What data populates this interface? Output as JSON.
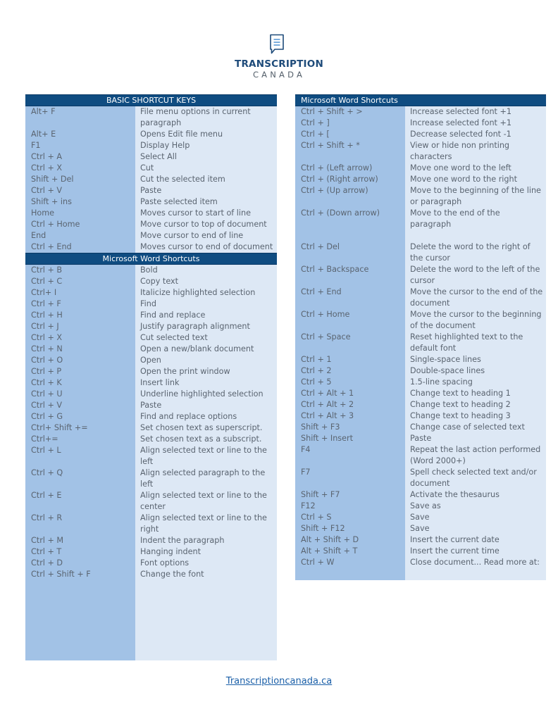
{
  "logo": {
    "icon": "document-chat-icon",
    "title": "TRANSCRIPTION",
    "subtitle": "CANADA"
  },
  "colors": {
    "header_bg": "#0f4c81",
    "key_column_bg": "#a2c2e6",
    "desc_column_bg": "#dde8f5",
    "text": "#5a6470",
    "brand": "#1e4b7a",
    "link": "#1a5fa8"
  },
  "left_panel": {
    "basic": {
      "title": "BASIC SHORTCUT KEYS",
      "rows": [
        {
          "key": "Alt+ F",
          "desc": "File menu options in current paragraph"
        },
        {
          "key": "Alt+ E",
          "desc": "Opens Edit file menu"
        },
        {
          "key": "F1",
          "desc": "Display Help"
        },
        {
          "key": "Ctrl + A",
          "desc": "Select All"
        },
        {
          "key": "Ctrl + X",
          "desc": "Cut"
        },
        {
          "key": "Shift + Del",
          "desc": "Cut the selected item"
        },
        {
          "key": "Ctrl + V",
          "desc": "Paste"
        },
        {
          "key": "Shift + ins",
          "desc": "Paste selected item"
        },
        {
          "key": "Home",
          "desc": "Moves cursor to start of line"
        },
        {
          "key": "Ctrl + Home",
          "desc": "Move cursor to top of document"
        },
        {
          "key": "End",
          "desc": "Move cursor to end of line"
        },
        {
          "key": "Ctrl + End",
          "desc": "Moves cursor to end of document"
        }
      ]
    },
    "word": {
      "title": "Microsoft Word Shortcuts",
      "rows": [
        {
          "key": "Ctrl + B",
          "desc": "Bold"
        },
        {
          "key": "Ctrl + C",
          "desc": "Copy text"
        },
        {
          "key": "Ctrl+ I",
          "desc": "Italicize highlighted selection"
        },
        {
          "key": "Ctrl + F",
          "desc": "Find"
        },
        {
          "key": "Ctrl + H",
          "desc": "Find and replace"
        },
        {
          "key": "Ctrl + J",
          "desc": "Justify paragraph alignment"
        },
        {
          "key": "Ctrl + X",
          "desc": "Cut selected text"
        },
        {
          "key": "Ctrl + N",
          "desc": "Open a new/blank document"
        },
        {
          "key": "Ctrl + O",
          "desc": "Open"
        },
        {
          "key": "Ctrl + P",
          "desc": "Open the print window"
        },
        {
          "key": "Ctrl + K",
          "desc": "Insert link"
        },
        {
          "key": "Ctrl + U",
          "desc": "Underline highlighted selection"
        },
        {
          "key": "Ctrl + V",
          "desc": "Paste"
        },
        {
          "key": "Ctrl + G",
          "desc": "Find and replace options"
        },
        {
          "key": "Ctrl+ Shift +=",
          "desc": "Set chosen text as superscript."
        },
        {
          "key": "Ctrl+=",
          "desc": "Set chosen text as a subscript."
        },
        {
          "key": "Ctrl + L",
          "desc": "Align selected text or line to the left"
        },
        {
          "key": "Ctrl + Q",
          "desc": "Align selected paragraph to the left"
        },
        {
          "key": "Ctrl + E",
          "desc": "Align selected text or line to the center"
        },
        {
          "key": "Ctrl + R",
          "desc": "Align selected text or line to the right"
        },
        {
          "key": "Ctrl + M",
          "desc": "Indent the paragraph"
        },
        {
          "key": "Ctrl + T",
          "desc": "Hanging indent"
        },
        {
          "key": "Ctrl + D",
          "desc": "Font options"
        },
        {
          "key": "Ctrl + Shift + F",
          "desc": "Change the font"
        }
      ]
    }
  },
  "right_panel": {
    "title": "Microsoft Word Shortcuts",
    "rows": [
      {
        "key": "Ctrl + Shift + >",
        "desc": "Increase selected font +1"
      },
      {
        "key": "Ctrl + ]",
        "desc": "Increase selected font +1"
      },
      {
        "key": "Ctrl + [",
        "desc": "Decrease selected font -1"
      },
      {
        "key": "Ctrl + Shift + *",
        "desc": "View or hide non printing characters"
      },
      {
        "key": "Ctrl + (Left arrow)",
        "desc": "Move one word to the left"
      },
      {
        "key": "Ctrl + (Right arrow)",
        "desc": "Move one word to the right"
      },
      {
        "key": "Ctrl + (Up arrow)",
        "desc": "Move to the beginning of the line or paragraph"
      },
      {
        "key": "Ctrl + (Down arrow)",
        "desc": "Move to the end of the paragraph"
      },
      {
        "key": "Ctrl + Del",
        "desc": "Delete the word to the right of the cursor"
      },
      {
        "key": "Ctrl + Backspace",
        "desc": "Delete the word to the left of the cursor"
      },
      {
        "key": "Ctrl + End",
        "desc": "Move the cursor to the end of the document"
      },
      {
        "key": "Ctrl + Home",
        "desc": "Move the cursor to the beginning of the document"
      },
      {
        "key": "Ctrl + Space",
        "desc": "Reset highlighted text to the default font"
      },
      {
        "key": "Ctrl + 1",
        "desc": "Single-space lines"
      },
      {
        "key": "Ctrl + 2",
        "desc": "Double-space lines"
      },
      {
        "key": "Ctrl + 5",
        "desc": "1.5-line spacing"
      },
      {
        "key": "Ctrl + Alt + 1",
        "desc": "Change text to heading 1"
      },
      {
        "key": "Ctrl + Alt + 2",
        "desc": "Change text to heading 2"
      },
      {
        "key": "Ctrl + Alt + 3",
        "desc": "Change text to heading 3"
      },
      {
        "key": "Shift + F3",
        "desc": "Change case of selected text"
      },
      {
        "key": "Shift + Insert",
        "desc": "Paste"
      },
      {
        "key": "F4",
        "desc": "Repeat the last action performed (Word 2000+)"
      },
      {
        "key": "F7",
        "desc": "Spell check selected text and/or document"
      },
      {
        "key": "Shift + F7",
        "desc": "Activate the thesaurus"
      },
      {
        "key": "F12",
        "desc": "Save as"
      },
      {
        "key": "Ctrl + S",
        "desc": "Save"
      },
      {
        "key": "Shift + F12",
        "desc": "Save"
      },
      {
        "key": "Alt + Shift + D",
        "desc": "Insert the current date"
      },
      {
        "key": "Alt + Shift + T",
        "desc": "Insert the current time"
      },
      {
        "key": "Ctrl + W",
        "desc": "Close document... Read more at:"
      }
    ]
  },
  "footer": {
    "link_text": "Transcriptioncanada.ca"
  }
}
